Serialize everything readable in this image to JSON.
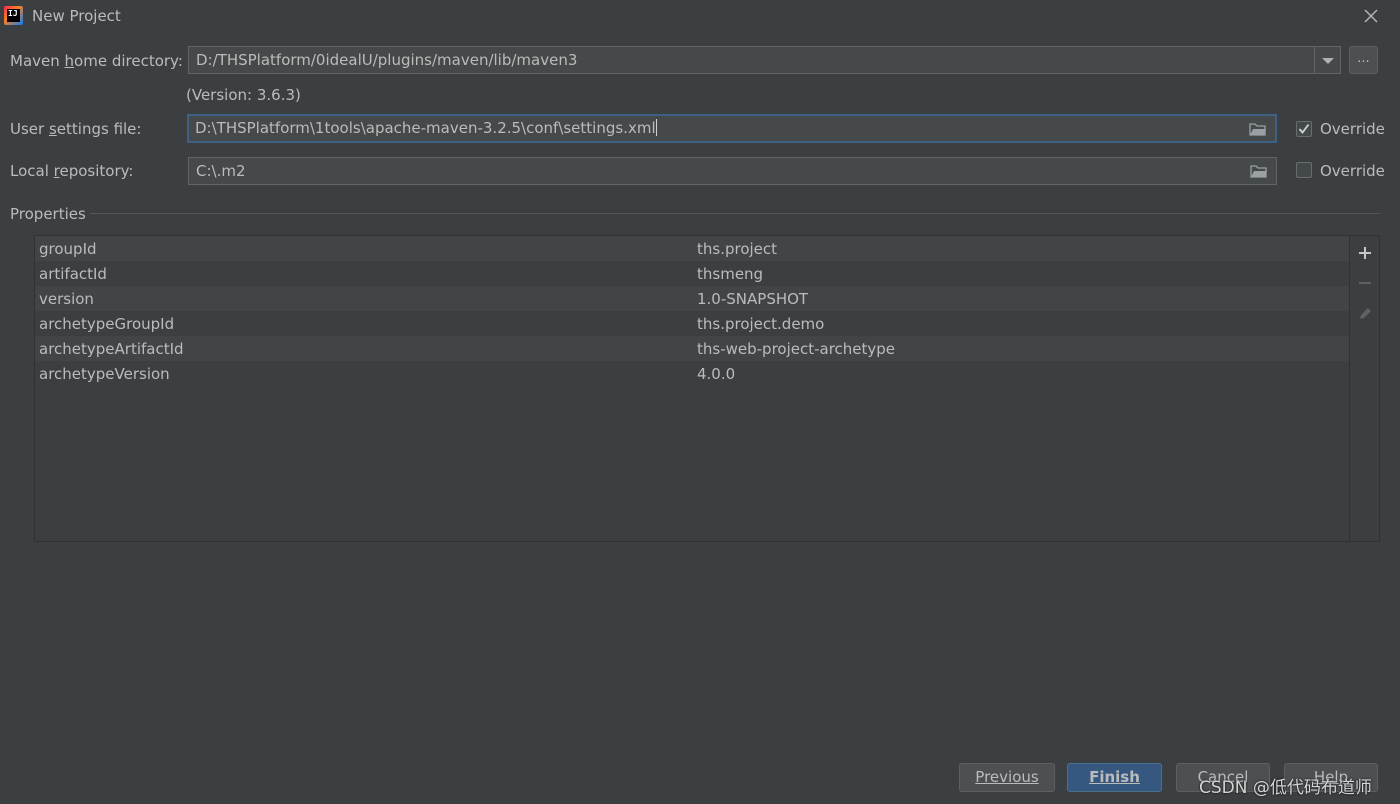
{
  "window": {
    "title": "New Project"
  },
  "maven_home": {
    "label_pre": "Maven ",
    "label_mnemonic": "h",
    "label_post": "ome directory:",
    "value": "D:/THSPlatform/0idealU/plugins/maven/lib/maven3",
    "browse_label": "...",
    "version_text": "(Version: 3.6.3)"
  },
  "user_settings": {
    "label_pre": "User ",
    "label_mnemonic": "s",
    "label_post": "ettings file:",
    "value": "D:\\THSPlatform\\1tools\\apache-maven-3.2.5\\conf\\settings.xml",
    "override_label": "Override",
    "override_checked": true
  },
  "local_repo": {
    "label_pre": "Local ",
    "label_mnemonic": "r",
    "label_post": "epository:",
    "value": "C:\\.m2",
    "override_label": "Override",
    "override_checked": false
  },
  "properties": {
    "title": "Properties",
    "rows": [
      {
        "key": "groupId",
        "value": "ths.project"
      },
      {
        "key": "artifactId",
        "value": "thsmeng"
      },
      {
        "key": "version",
        "value": "1.0-SNAPSHOT"
      },
      {
        "key": "archetypeGroupId",
        "value": "ths.project.demo"
      },
      {
        "key": "archetypeArtifactId",
        "value": "ths-web-project-archetype"
      },
      {
        "key": "archetypeVersion",
        "value": "4.0.0"
      }
    ]
  },
  "buttons": {
    "previous": "Previous",
    "finish": "Finish",
    "cancel": "Cancel",
    "help": "Help"
  },
  "watermark": "CSDN @低代码布道师"
}
